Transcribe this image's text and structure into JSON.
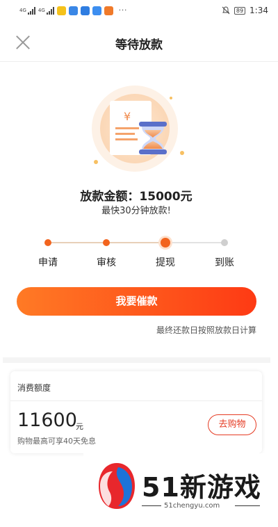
{
  "status_bar": {
    "network_labels": [
      "4G",
      "4G"
    ],
    "battery": "89",
    "time": "1:34",
    "more_dots": "···"
  },
  "header": {
    "title": "等待放款"
  },
  "illustration": {
    "currency_symbol": "¥"
  },
  "loan": {
    "amount_label": "放款金额：",
    "amount_value": "15000元",
    "subtitle": "最快30分钟放款!"
  },
  "steps": [
    {
      "label": "申请",
      "state": "done"
    },
    {
      "label": "审核",
      "state": "done"
    },
    {
      "label": "提现",
      "state": "current"
    },
    {
      "label": "到账",
      "state": "todo"
    }
  ],
  "cta": {
    "label": "我要催款",
    "note": "最终还款日按照放款日计算"
  },
  "credit_card": {
    "title": "消费额度",
    "value": "11600",
    "unit": "元",
    "description": "购物最高可享40天免息",
    "button_label": "去购物"
  },
  "watermark": {
    "brand": "51新游戏",
    "url": "51chengyu.com"
  },
  "colors": {
    "accent": "#f2641e",
    "cta_start": "#ff7a25",
    "cta_end": "#fe3a14",
    "shop_red": "#e53b23"
  }
}
